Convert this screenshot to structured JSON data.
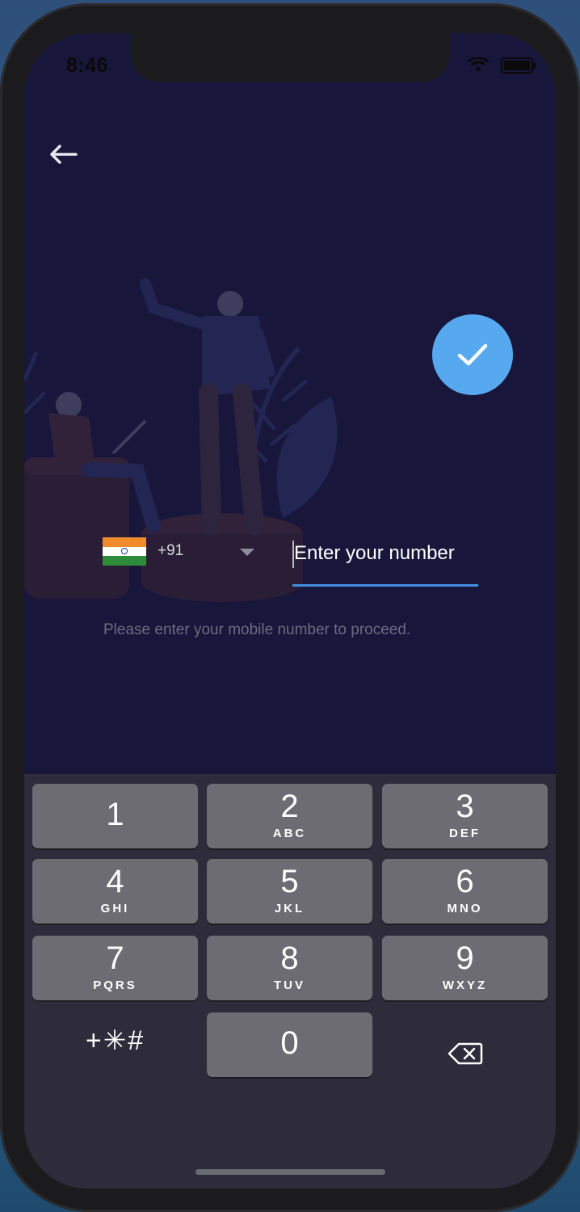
{
  "status_bar": {
    "time": "8:46"
  },
  "header": {
    "back_icon": "arrow-left-icon"
  },
  "confirm": {
    "icon": "check-icon",
    "color": "#56a9ee"
  },
  "phone_form": {
    "country_flag": "india-flag",
    "dial_code": "+91",
    "placeholder": "Enter your number",
    "helper_text": "Please enter your mobile number to proceed."
  },
  "colors": {
    "background": "#18163a",
    "accent": "#3f8fe2",
    "key": "#6d6c73",
    "keyboard": "#2e2c3a"
  },
  "keypad": {
    "keys": [
      {
        "digit": "1",
        "letters": ""
      },
      {
        "digit": "2",
        "letters": "ABC"
      },
      {
        "digit": "3",
        "letters": "DEF"
      },
      {
        "digit": "4",
        "letters": "GHI"
      },
      {
        "digit": "5",
        "letters": "JKL"
      },
      {
        "digit": "6",
        "letters": "MNO"
      },
      {
        "digit": "7",
        "letters": "PQRS"
      },
      {
        "digit": "8",
        "letters": "TUV"
      },
      {
        "digit": "9",
        "letters": "WXYZ"
      }
    ],
    "zero": {
      "digit": "0"
    },
    "symbols": "+✳#",
    "delete_icon": "backspace-icon"
  }
}
